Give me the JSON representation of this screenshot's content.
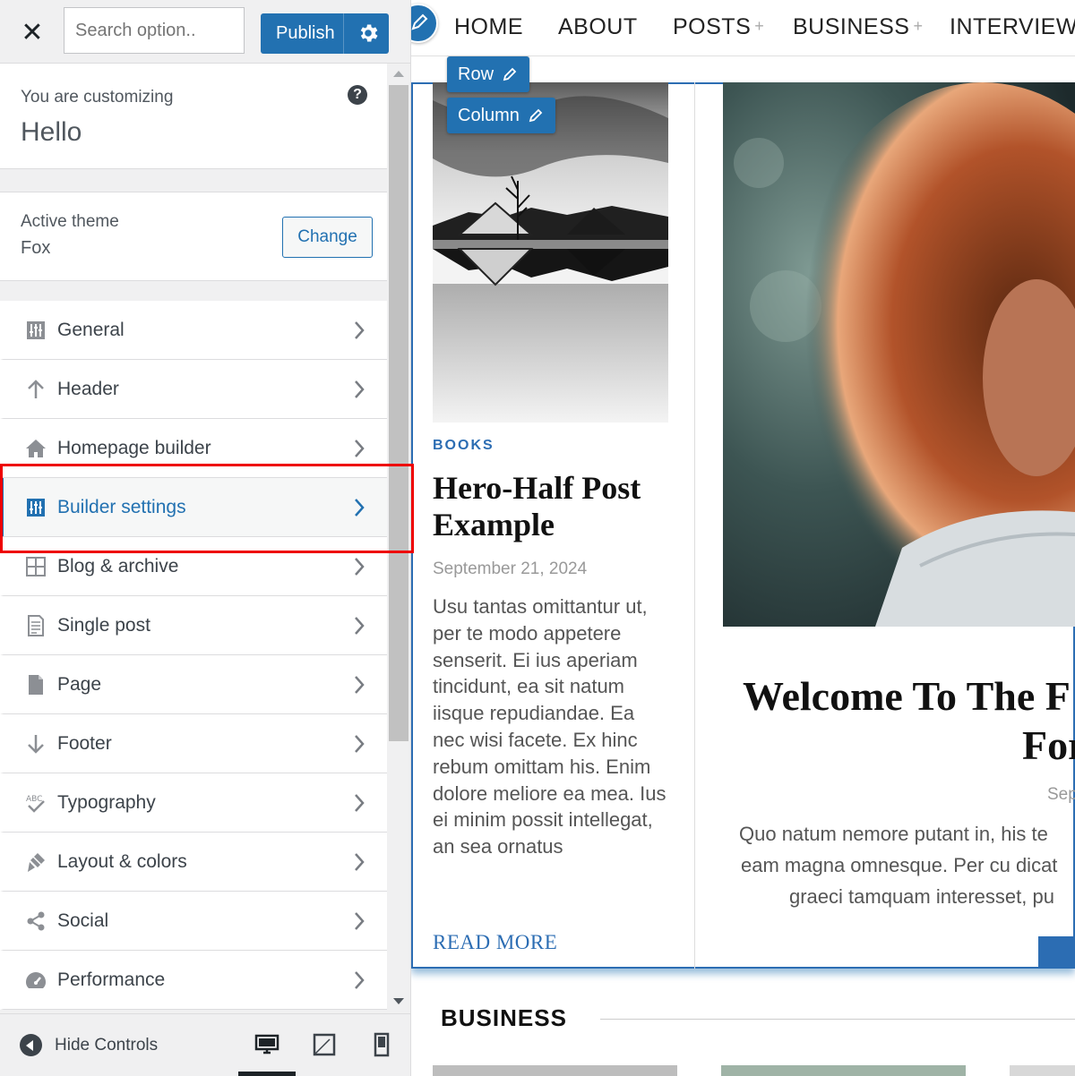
{
  "sidebar": {
    "close_label": "✕",
    "search_placeholder": "Search option..",
    "publish_label": "Publish",
    "customizing_label": "You are customizing",
    "customizing_title": "Hello",
    "help_label": "?",
    "active_theme_label": "Active theme",
    "active_theme_name": "Fox",
    "change_label": "Change",
    "items": [
      {
        "label": "General",
        "icon": "sliders-icon"
      },
      {
        "label": "Header",
        "icon": "arrow-up-icon"
      },
      {
        "label": "Homepage builder",
        "icon": "home-icon"
      },
      {
        "label": "Builder settings",
        "icon": "sliders-icon",
        "active": true
      },
      {
        "label": "Blog & archive",
        "icon": "grid-icon"
      },
      {
        "label": "Single post",
        "icon": "document-icon"
      },
      {
        "label": "Page",
        "icon": "page-icon"
      },
      {
        "label": "Footer",
        "icon": "arrow-down-icon"
      },
      {
        "label": "Typography",
        "icon": "typography-icon"
      },
      {
        "label": "Layout & colors",
        "icon": "brush-icon"
      },
      {
        "label": "Social",
        "icon": "share-icon"
      },
      {
        "label": "Performance",
        "icon": "dashboard-icon"
      }
    ],
    "hide_controls_label": "Hide Controls",
    "devices": [
      "desktop-icon",
      "tablet-icon",
      "mobile-icon"
    ]
  },
  "preview": {
    "nav": [
      {
        "label": "HOME",
        "plus": ""
      },
      {
        "label": "ABOUT",
        "plus": ""
      },
      {
        "label": "POSTS",
        "plus": "+"
      },
      {
        "label": "BUSINESS",
        "plus": "+"
      },
      {
        "label": "INTERVIEW",
        "plus": ""
      }
    ],
    "row_label": "Row",
    "column_label": "Column",
    "post1": {
      "category": "BOOKS",
      "title": "Hero-Half Post Example",
      "date": "September 21, 2024",
      "excerpt": "Usu tantas omittantur ut, per te modo appetere senserit. Ei ius aperiam tincidunt, ea sit natum iisque repudiandae. Ea nec wisi facete. Ex hinc rebum omittam his. Enim dolore meliore ea mea. Ius ei minim possit intellegat, an sea ornatus",
      "read_more": "READ MORE"
    },
    "post2": {
      "title_line1": "Welcome To The F",
      "title_line2": "For",
      "date": "Sep",
      "excerpt_line1": "Quo natum nemore putant in, his te",
      "excerpt_line2": "eam magna omnesque. Per cu dicat",
      "excerpt_line3": "graeci tamquam interesset, pu"
    },
    "section_title": "BUSINESS"
  },
  "colors": {
    "accent": "#2271b1",
    "highlight": "#e00000"
  }
}
